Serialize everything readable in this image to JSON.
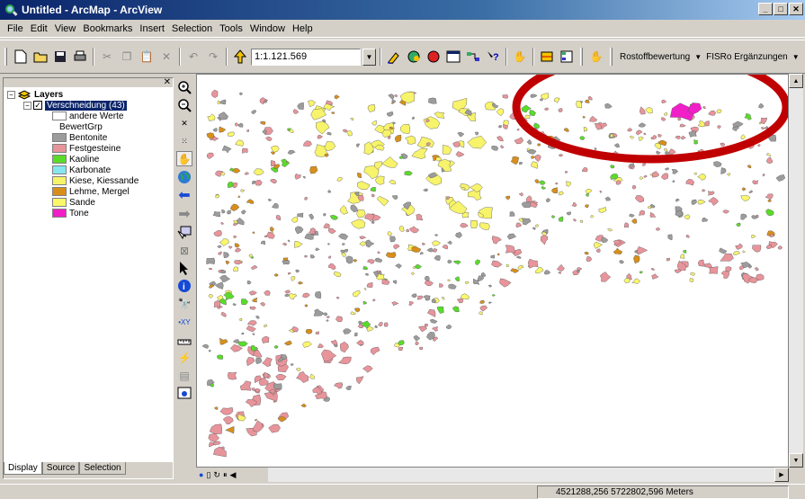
{
  "window": {
    "title": "Untitled - ArcMap - ArcView"
  },
  "menus": [
    "File",
    "Edit",
    "View",
    "Bookmarks",
    "Insert",
    "Selection",
    "Tools",
    "Window",
    "Help"
  ],
  "toolbar": {
    "scale_value": "1:1.121.569",
    "rostoff_label": "Rostoffbewertung",
    "fisro_label": "FISRo Ergänzungen"
  },
  "toc": {
    "root_label": "Layers",
    "layer_label": "Verschneidung (43)",
    "field_name": "BewertGrp",
    "legend": [
      {
        "label": "andere Werte",
        "color": "#ffffff"
      },
      {
        "label": "Bentonite",
        "color": "#9c9c9c"
      },
      {
        "label": "Festgesteine",
        "color": "#e8949b"
      },
      {
        "label": "Kaoline",
        "color": "#5adb2a"
      },
      {
        "label": "Karbonate",
        "color": "#87e6f0"
      },
      {
        "label": "Kiese, Kiessande",
        "color": "#f7f36b"
      },
      {
        "label": "Lehme, Mergel",
        "color": "#d88f1a"
      },
      {
        "label": "Sande",
        "color": "#fbf76a"
      },
      {
        "label": "Tone",
        "color": "#f01fc8"
      }
    ],
    "tabs": [
      "Display",
      "Source",
      "Selection"
    ]
  },
  "status": {
    "coordinates": "4521288,256  5722802,596 Meters"
  },
  "annotation_color": "#c00000"
}
